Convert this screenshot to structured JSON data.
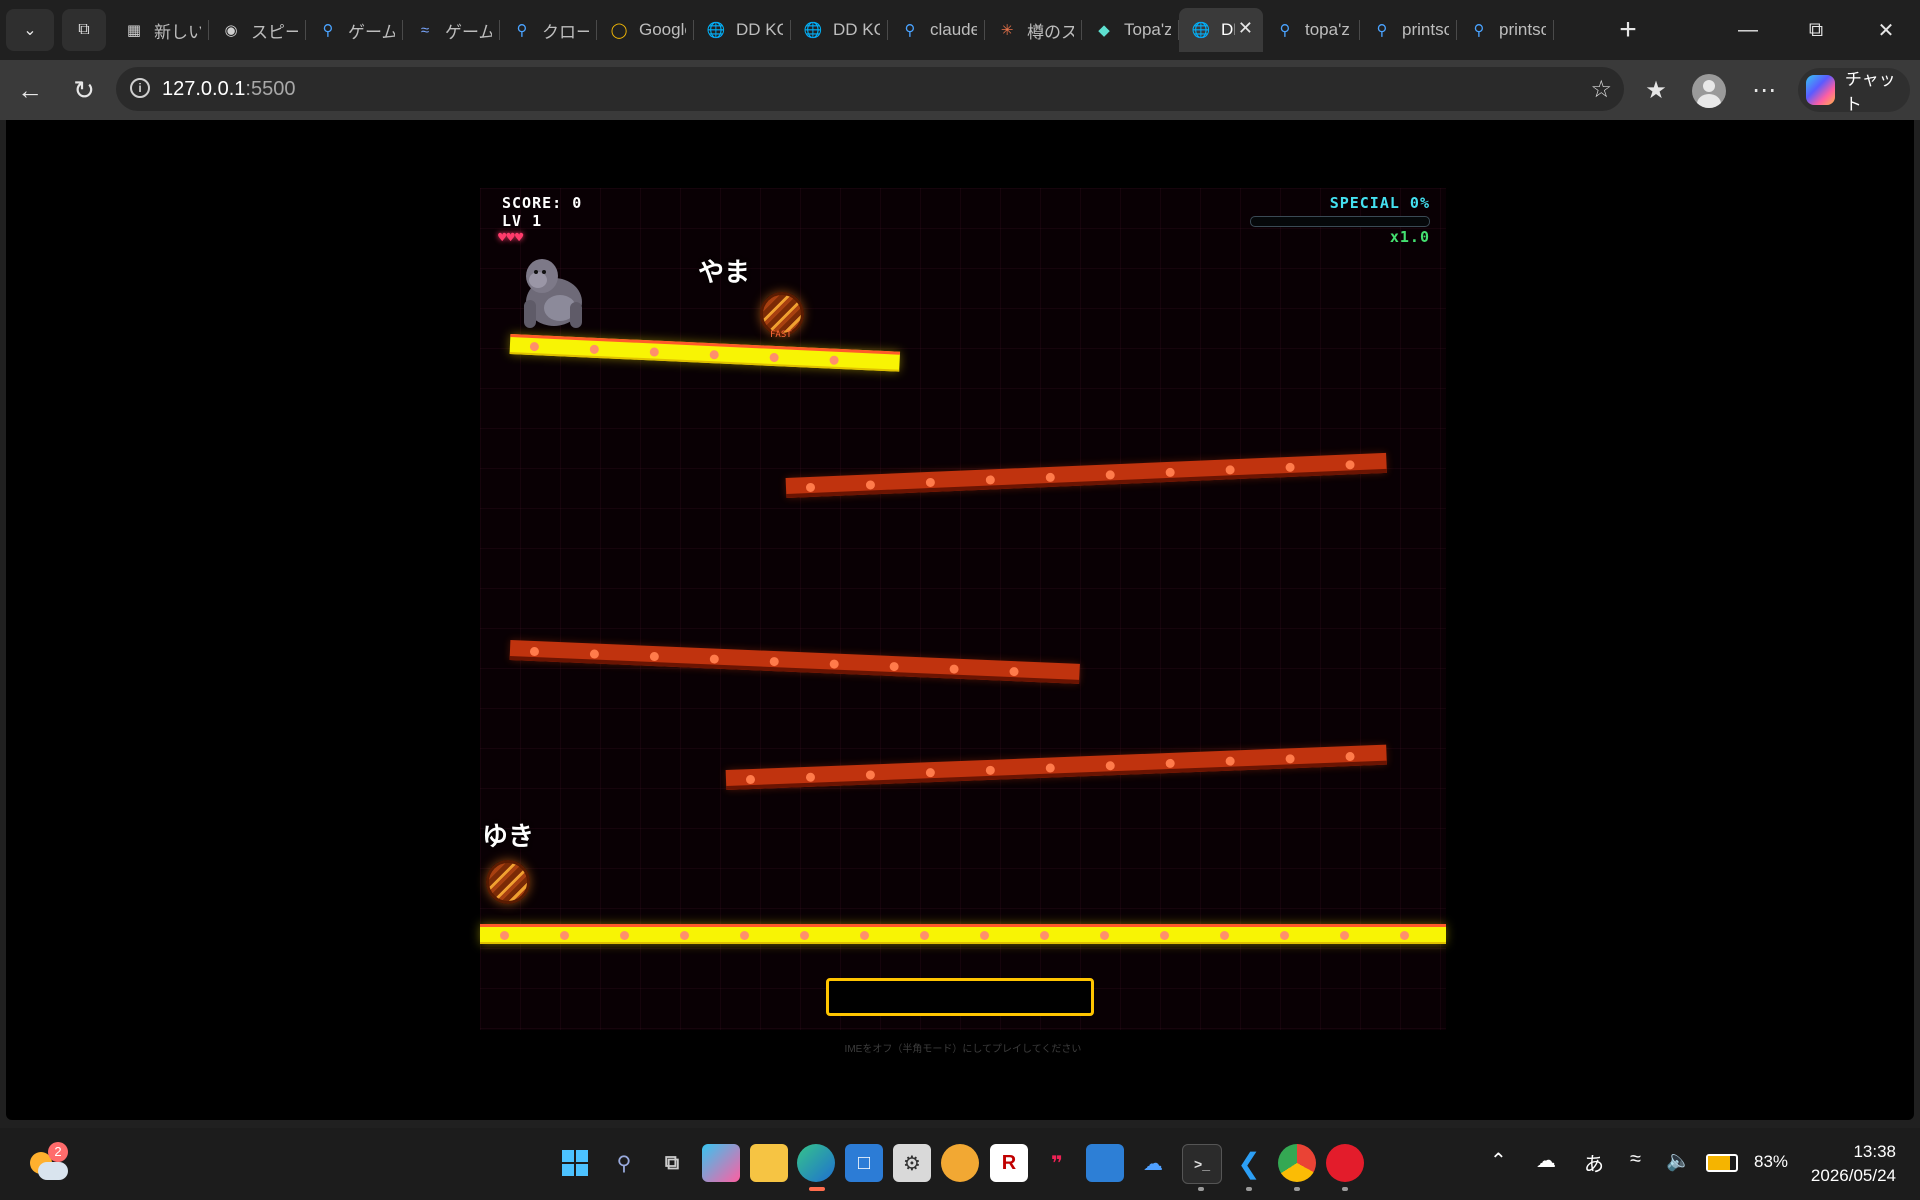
{
  "browser": {
    "tabs": [
      {
        "title": "新しいタブ",
        "icon": "new-tab-page-icon"
      },
      {
        "title": "スピードタイピング",
        "icon": "github-icon"
      },
      {
        "title": "ゲームの作り方",
        "icon": "search-icon"
      },
      {
        "title": "ゲームプログラミング",
        "icon": "wave-icon"
      },
      {
        "title": "クローム拡張",
        "icon": "search-icon"
      },
      {
        "title": "Google",
        "icon": "chrome-icon"
      },
      {
        "title": "DD KONG",
        "icon": "globe-icon"
      },
      {
        "title": "DD KONG",
        "icon": "globe-icon"
      },
      {
        "title": "claude",
        "icon": "search-icon"
      },
      {
        "title": "樽のスピード",
        "icon": "claude-icon"
      },
      {
        "title": "Topa'z",
        "icon": "topaz-icon"
      },
      {
        "title": "DD KONG",
        "icon": "globe-icon",
        "active": true
      },
      {
        "title": "topa'z",
        "icon": "search-icon"
      },
      {
        "title": "printscreen",
        "icon": "search-icon"
      },
      {
        "title": "printscreen",
        "icon": "search-icon"
      }
    ],
    "address": {
      "host": "127.0.0.1",
      "port": ":5500"
    },
    "copilot_label": "チャット"
  },
  "game": {
    "score_label": "SCORE: 0",
    "level_label": "LV 1",
    "lives": "♥♥♥",
    "special_label": "SPECIAL 0%",
    "special_level": 0,
    "multiplier": "x1.0",
    "barrels": [
      {
        "word": "やま"
      },
      {
        "word": "ゆき"
      }
    ],
    "tiny_label": "FAST",
    "ime_note": "IMEをオフ（半角モード）にしてプレイしてください",
    "input_value": ""
  },
  "taskbar": {
    "weather_badge": "2",
    "ime_indicator": "あ",
    "battery": "83%",
    "time": "13:38",
    "date": "2026/05/24"
  },
  "colors": {
    "girder": "#c0330e",
    "girder_hot": "#f8f404",
    "special": "#44e0f0",
    "multiplier": "#44e070",
    "input_border": "#ffc400"
  }
}
